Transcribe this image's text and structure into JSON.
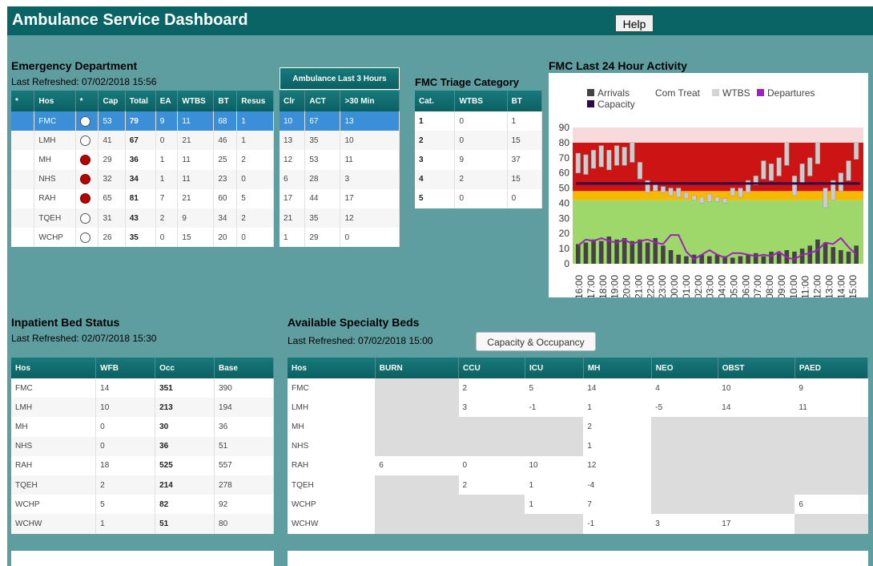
{
  "app_title": "Ambulance Service Dashboard",
  "help_label": "Help",
  "ed": {
    "title": "Emergency Department",
    "refreshed": "Last Refreshed: 07/02/2018 15:56",
    "headers": [
      "*",
      "Hos",
      "*",
      "Cap",
      "Total",
      "EA",
      "WTBS",
      "BT",
      "Resus"
    ],
    "rows": [
      {
        "hos": "FMC",
        "status": "white",
        "cap": "53",
        "total": "79",
        "ea": "9",
        "wtbs": "11",
        "bt": "68",
        "resus": "1"
      },
      {
        "hos": "LMH",
        "status": "white",
        "cap": "41",
        "total": "67",
        "ea": "0",
        "wtbs": "21",
        "bt": "46",
        "resus": "1"
      },
      {
        "hos": "MH",
        "status": "red",
        "cap": "29",
        "total": "36",
        "ea": "1",
        "wtbs": "11",
        "bt": "25",
        "resus": "2"
      },
      {
        "hos": "NHS",
        "status": "red",
        "cap": "32",
        "total": "34",
        "ea": "1",
        "wtbs": "11",
        "bt": "23",
        "resus": "0"
      },
      {
        "hos": "RAH",
        "status": "red",
        "cap": "65",
        "total": "81",
        "ea": "7",
        "wtbs": "21",
        "bt": "60",
        "resus": "5"
      },
      {
        "hos": "TQEH",
        "status": "white",
        "cap": "31",
        "total": "43",
        "ea": "2",
        "wtbs": "9",
        "bt": "34",
        "resus": "2"
      },
      {
        "hos": "WCHP",
        "status": "white",
        "cap": "26",
        "total": "35",
        "ea": "0",
        "wtbs": "15",
        "bt": "20",
        "resus": "0"
      }
    ]
  },
  "amb": {
    "title": "Ambulance Last 3 Hours",
    "headers": [
      "Clr",
      "ACT",
      ">30 Min"
    ],
    "rows": [
      [
        "10",
        "67",
        "13"
      ],
      [
        "13",
        "35",
        "10"
      ],
      [
        "12",
        "53",
        "11"
      ],
      [
        "6",
        "28",
        "3"
      ],
      [
        "17",
        "44",
        "17"
      ],
      [
        "21",
        "35",
        "12"
      ],
      [
        "1",
        "29",
        "0"
      ]
    ]
  },
  "triage": {
    "title": "FMC Triage Category",
    "headers": [
      "Cat.",
      "WTBS",
      "BT"
    ],
    "rows": [
      [
        "1",
        "0",
        "1"
      ],
      [
        "2",
        "0",
        "15"
      ],
      [
        "3",
        "9",
        "37"
      ],
      [
        "4",
        "2",
        "15"
      ],
      [
        "5",
        "0",
        "0"
      ]
    ]
  },
  "activity": {
    "title": "FMC Last 24 Hour Activity",
    "legend": [
      "Arrivals",
      "Com Treat",
      "WTBS",
      "Departures",
      "Capacity"
    ]
  },
  "colors": {
    "header": "#0a6466",
    "panel": "#5f9ea0",
    "arrivals": "#444444",
    "wtbs": "#cccccc",
    "departures": "#a020c0",
    "capacity": "#2a0a4a",
    "band_red": "#cc1414",
    "band_orange": "#f7b800",
    "band_green": "#9fd86a",
    "band_pink": "#f8dada"
  },
  "chart_data": {
    "type": "bar",
    "title": "FMC Last 24 Hour Activity",
    "xlabel": "",
    "ylabel": "",
    "ylim": [
      0,
      90
    ],
    "yticks": [
      0,
      10,
      20,
      30,
      40,
      50,
      60,
      70,
      80,
      90
    ],
    "grid": false,
    "legend_position": "top",
    "categories": [
      "16:00",
      "17:00",
      "18:00",
      "19:00",
      "20:00",
      "21:00",
      "22:00",
      "23:00",
      "00:00",
      "01:00",
      "02:00",
      "03:00",
      "04:00",
      "05:00",
      "06:00",
      "07:00",
      "08:00",
      "09:00",
      "10:00",
      "11:00",
      "12:00",
      "13:00",
      "14:00",
      "15:00"
    ],
    "bars": [
      {
        "x": "16:00",
        "low": 60,
        "high": 73
      },
      {
        "x": "16:00",
        "low": 59,
        "high": 72
      },
      {
        "x": "17:00",
        "low": 63,
        "high": 75
      },
      {
        "x": "17:00",
        "low": 64,
        "high": 78
      },
      {
        "x": "18:00",
        "low": 62,
        "high": 75
      },
      {
        "x": "18:00",
        "low": 65,
        "high": 78
      },
      {
        "x": "19:00",
        "low": 65,
        "high": 77
      },
      {
        "x": "19:00",
        "low": 67,
        "high": 80
      },
      {
        "x": "20:00",
        "low": 56,
        "high": 67
      },
      {
        "x": "20:00",
        "low": 47,
        "high": 55
      },
      {
        "x": "21:00",
        "low": 48,
        "high": 52
      },
      {
        "x": "21:00",
        "low": 47,
        "high": 51
      },
      {
        "x": "22:00",
        "low": 45,
        "high": 50
      },
      {
        "x": "22:00",
        "low": 44,
        "high": 50
      },
      {
        "x": "23:00",
        "low": 43,
        "high": 47
      },
      {
        "x": "23:00",
        "low": 42,
        "high": 45
      },
      {
        "x": "00:00",
        "low": 40,
        "high": 44
      },
      {
        "x": "00:00",
        "low": 41,
        "high": 46
      },
      {
        "x": "01:00",
        "low": 41,
        "high": 44
      },
      {
        "x": "01:00",
        "low": 40,
        "high": 43
      },
      {
        "x": "02:00",
        "low": 45,
        "high": 50
      },
      {
        "x": "02:00",
        "low": 44,
        "high": 50
      },
      {
        "x": "03:00",
        "low": 47,
        "high": 55
      },
      {
        "x": "03:00",
        "low": 52,
        "high": 58
      },
      {
        "x": "04:00",
        "low": 56,
        "high": 68
      },
      {
        "x": "04:00",
        "low": 55,
        "high": 66
      },
      {
        "x": "05:00",
        "low": 58,
        "high": 70
      },
      {
        "x": "05:00",
        "low": 65,
        "high": 80
      }
    ],
    "series": [
      {
        "name": "Arrivals",
        "type": "bar",
        "values": [
          13,
          14,
          16,
          15,
          18,
          16,
          17,
          15,
          16,
          14,
          17,
          12,
          9,
          6,
          5,
          6,
          6,
          5,
          6,
          5,
          4,
          5,
          6,
          7,
          5,
          8,
          7,
          9,
          8,
          10,
          12,
          16,
          14,
          11,
          9,
          8,
          12
        ]
      },
      {
        "name": "Departures",
        "type": "line",
        "values": [
          12,
          16,
          15,
          17,
          15,
          14,
          16,
          13,
          15,
          16,
          14,
          13,
          19,
          19,
          8,
          3,
          6,
          9,
          6,
          4,
          7,
          7,
          6,
          5,
          6,
          5,
          8,
          4,
          3,
          6,
          7,
          9,
          14,
          13,
          17,
          11,
          6
        ]
      },
      {
        "name": "Capacity",
        "type": "line",
        "values": [
          53,
          53
        ]
      }
    ],
    "bands": [
      {
        "from": 0,
        "to": 42,
        "color": "green"
      },
      {
        "from": 42,
        "to": 48,
        "color": "orange"
      },
      {
        "from": 48,
        "to": 80,
        "color": "red"
      },
      {
        "from": 80,
        "to": 90,
        "color": "pink"
      }
    ]
  },
  "beds": {
    "title": "Inpatient Bed Status",
    "refreshed": "Last Refreshed: 02/07/2018 15:30",
    "headers": [
      "Hos",
      "WFB",
      "Occ",
      "Base"
    ],
    "rows": [
      [
        "FMC",
        "14",
        "351",
        "390"
      ],
      [
        "LMH",
        "10",
        "213",
        "194"
      ],
      [
        "MH",
        "0",
        "30",
        "36"
      ],
      [
        "NHS",
        "0",
        "36",
        "51"
      ],
      [
        "RAH",
        "18",
        "525",
        "557"
      ],
      [
        "TQEH",
        "2",
        "214",
        "278"
      ],
      [
        "WCHP",
        "5",
        "82",
        "92"
      ],
      [
        "WCHW",
        "1",
        "51",
        "80"
      ]
    ]
  },
  "spec": {
    "title": "Available Specialty Beds",
    "refreshed": "Last Refreshed: 07/02/2018 15:00",
    "button": "Capacity & Occupancy",
    "headers": [
      "Hos",
      "BURN",
      "CCU",
      "ICU",
      "MH",
      "NEO",
      "OBST",
      "PAED"
    ],
    "rows": [
      [
        "FMC",
        null,
        "2",
        "5",
        "14",
        "4",
        "10",
        "9"
      ],
      [
        "LMH",
        null,
        "3",
        "-1",
        "1",
        "-5",
        "14",
        "11"
      ],
      [
        "MH",
        null,
        null,
        null,
        "2",
        null,
        null,
        null
      ],
      [
        "NHS",
        null,
        null,
        null,
        "1",
        null,
        null,
        null
      ],
      [
        "RAH",
        "6",
        "0",
        "10",
        "12",
        null,
        null,
        null
      ],
      [
        "TQEH",
        null,
        "2",
        "1",
        "-4",
        null,
        null,
        null
      ],
      [
        "WCHP",
        null,
        null,
        "1",
        "7",
        null,
        null,
        "6"
      ],
      [
        "WCHW",
        null,
        null,
        null,
        "-1",
        "3",
        "17",
        null
      ]
    ]
  }
}
